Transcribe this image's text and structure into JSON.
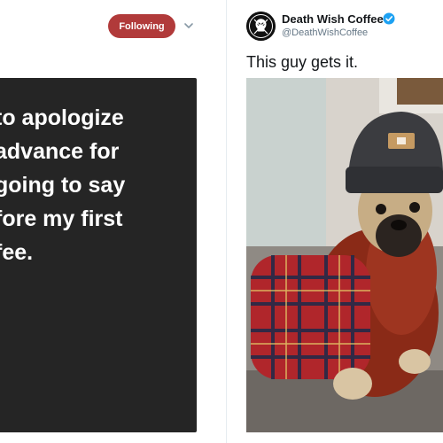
{
  "left_tweet": {
    "follow_button_label": "Following",
    "quote_lines": [
      "to apologize",
      "advance for",
      "going to say",
      "fore my first",
      "fee."
    ]
  },
  "right_tweet": {
    "display_name": "Death Wish Coffee",
    "handle": "@DeathWishCoffee",
    "text": "This guy gets it.",
    "image_icon": "pug-in-beanie-photo",
    "accent_color": "#1da1f2"
  },
  "colors": {
    "follow_button": "#b13a3a",
    "quote_card": "#252525",
    "verified_badge": "#1da1f2"
  }
}
